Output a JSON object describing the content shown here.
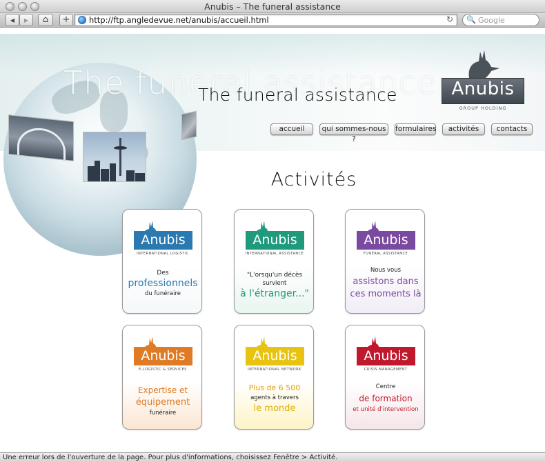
{
  "window": {
    "title": "Anubis – The funeral assistance"
  },
  "toolbar": {
    "back_glyph": "◀",
    "forward_glyph": "▶",
    "home_glyph": "⌂",
    "add_glyph": "+",
    "url": "http://ftp.angledevue.net/anubis/accueil.html",
    "reload_glyph": "↻",
    "search_placeholder": "Google",
    "search_icon": "🔍"
  },
  "header": {
    "ghost_title": "The funeral assistance",
    "title": "The funeral assistance",
    "logo_word": "Anubis",
    "logo_sub": "GROUP HOLDING"
  },
  "nav": [
    {
      "label": "accueil"
    },
    {
      "label": "qui sommes-nous ?"
    },
    {
      "label": "formulaires"
    },
    {
      "label": "activités"
    },
    {
      "label": "contacts"
    }
  ],
  "section_title": "Activités",
  "cards": [
    {
      "word": "Anubis",
      "sub": "INTERNATIONAL LOGISTIC",
      "color": "#2a79b0",
      "lines": [
        "Des",
        "professionnels",
        "du funéraire"
      ]
    },
    {
      "word": "Anubis",
      "sub": "INTERNATIONAL ASSISTANCE",
      "color": "#1f9a7c",
      "lines": [
        "\"L'orsqu'un décès",
        "survient",
        "à l'étranger...\""
      ]
    },
    {
      "word": "Anubis",
      "sub": "FUNERAL ASSISTANCE",
      "color": "#7a4aa0",
      "lines": [
        "Nous vous",
        "assistons dans",
        "ces moments là"
      ]
    },
    {
      "word": "Anubis",
      "sub": "E-LOGISTIC & SERVICES",
      "color": "#e07a24",
      "lines": [
        "Expertise et",
        "équipement",
        "funéraire"
      ]
    },
    {
      "word": "Anubis",
      "sub": "INTERNATIONAL NETWORK",
      "color": "#e8c30f",
      "lines": [
        "Plus de 6 500",
        "agents à travers",
        "le monde"
      ]
    },
    {
      "word": "Anubis",
      "sub": "CRISIS MANAGEMENT",
      "color": "#c0182c",
      "lines": [
        "Centre",
        "de formation",
        "et unité d'intervention"
      ]
    }
  ],
  "status": "Une erreur lors de l'ouverture de la page. Pour plus d'informations, choisissez Fenêtre > Activité."
}
